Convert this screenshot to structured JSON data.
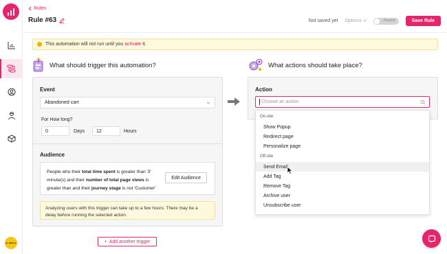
{
  "sidebar": {
    "org_badge": "EL MERCA",
    "nav": [
      {
        "icon": "analytics-icon"
      },
      {
        "icon": "automation-icon",
        "active": true
      },
      {
        "icon": "contacts-icon"
      },
      {
        "icon": "audience-icon"
      },
      {
        "icon": "integrations-icon"
      }
    ]
  },
  "header": {
    "back_label": "Rules",
    "title": "Rule #63",
    "save_status": "Not saved yet",
    "options_label": "Options",
    "toggle_label": "Paused",
    "save_label": "Save Rule"
  },
  "banner": {
    "text_before": "This automation will not run until you",
    "link": "activate",
    "text_after": "it."
  },
  "trigger": {
    "heading": "What should trigger this automation?",
    "event_label": "Event",
    "event_value": "Abandoned cart",
    "how_long_label": "For How long?",
    "days_value": "0",
    "days_label": "Days",
    "hours_value": "12",
    "hours_label": "Hours",
    "audience_label": "Audience",
    "audience": {
      "t1": "People who their ",
      "b1": "total time spent",
      "t2": " is greater than '3' minute(s) and their ",
      "b2": "number of total page views",
      "t3": " is greater than and their ",
      "b3": "journey stage",
      "t4": " is not 'Customer'"
    },
    "edit_audience_label": "Edit Audience",
    "note": "Analyzing users with this trigger can take up to a few hours. There may be a delay before running the selected action.",
    "add_trigger_label": "Add another trigger"
  },
  "action": {
    "heading": "What actions should take place?",
    "label": "Action",
    "placeholder": "Choose an action",
    "groups": [
      {
        "label": "On-site",
        "options": [
          "Show Popup",
          "Redirect page",
          "Personalize page"
        ]
      },
      {
        "label": "Off-site",
        "options": [
          "Send Email",
          "Add Tag",
          "Remove Tag",
          "Archive user",
          "Unsubscribe user"
        ]
      }
    ],
    "hovered_option": "Send Email"
  },
  "colors": {
    "brand": "#e5246b",
    "banner_bg": "#fef8dd",
    "panel_bg": "#f6f6f6"
  }
}
